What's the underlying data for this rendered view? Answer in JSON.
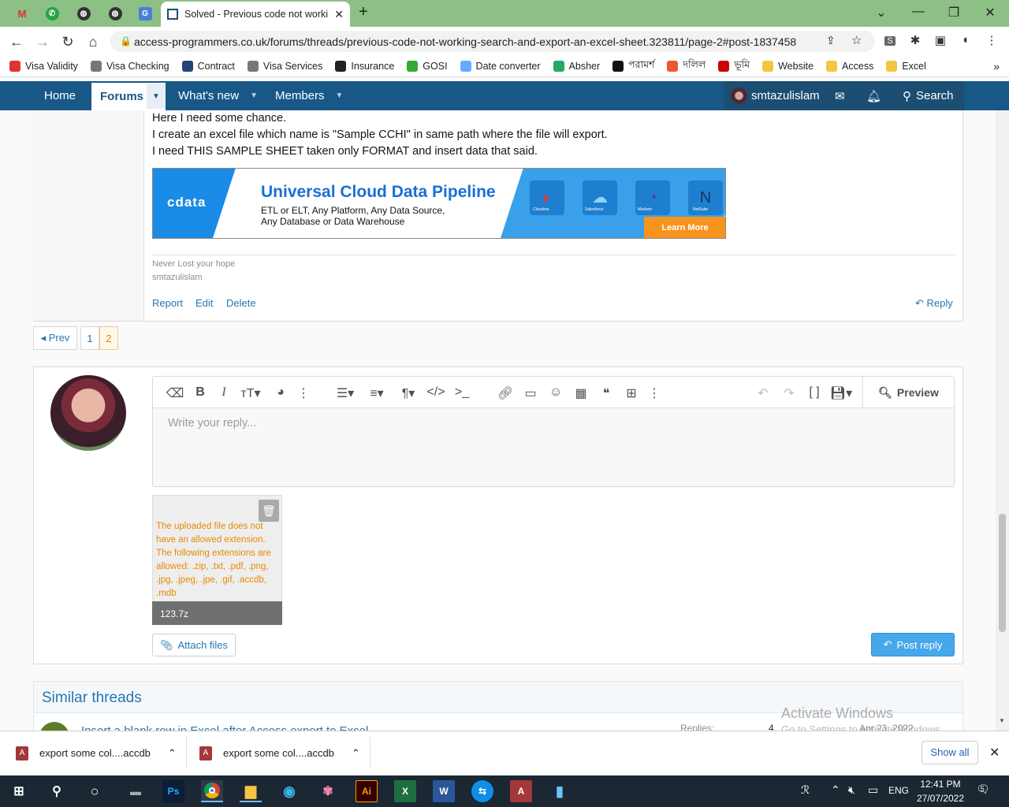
{
  "browser": {
    "active_tab_title": "Solved - Previous code not worki",
    "url": "access-programmers.co.uk/forums/threads/previous-code-not-working-search-and-export-an-excel-sheet.323811/page-2#post-1837458",
    "new_tab_label": "+",
    "bookmarks": [
      "Visa Validity",
      "Visa Checking",
      "Contract",
      "Visa Services",
      "Insurance",
      "GOSI",
      "Date converter",
      "Absher",
      "পরামর্শ",
      "দলিল",
      "ভূমি",
      "Website",
      "Access",
      "Excel"
    ],
    "bookmark_colors": [
      "#d33",
      "#777",
      "#247",
      "#777",
      "#222",
      "#3a3",
      "#6af",
      "#2a6",
      "#111",
      "#e53",
      "#c00",
      "#f5c542",
      "#f5c542",
      "#f5c542"
    ],
    "more_bookmarks": "»"
  },
  "site_nav": {
    "home": "Home",
    "forums": "Forums",
    "whats_new": "What's new",
    "members": "Members",
    "username": "smtazulislam",
    "search": "Search"
  },
  "post": {
    "lines": [
      "Here I need some chance.",
      "I create an excel file which name is \"Sample CCHI\" in same path where the file will export.",
      "I need THIS SAMPLE SHEET taken only FORMAT and insert data that said."
    ],
    "signature_line1": "Never Lost your hope",
    "signature_line2": "smtazulislam",
    "actions": {
      "report": "Report",
      "edit": "Edit",
      "delete": "Delete",
      "reply": "Reply"
    }
  },
  "ad": {
    "brand": "cdata",
    "headline": "Universal Cloud Data Pipeline",
    "sub1": "ETL or ELT, Any Platform, Any Data Source,",
    "sub2": "Any Database or Data Warehouse",
    "cta": "Learn More",
    "tiles": [
      "Cloudera",
      "Salesforce",
      "Marketo",
      "NetSuite"
    ]
  },
  "pagination": {
    "prev": "◂ Prev",
    "pages": [
      "1",
      "2"
    ],
    "current": "2"
  },
  "editor": {
    "placeholder": "Write your reply...",
    "preview": "Preview",
    "upload_error": "The uploaded file does not have an allowed extension. The following extensions are allowed: .zip, .txt, .pdf, .png, .jpg, .jpeg, .jpe, .gif, .accdb, .mdb",
    "upload_filename": "123.7z",
    "attach_files": "Attach files",
    "post_reply": "Post reply"
  },
  "similar": {
    "heading": "Similar threads",
    "row_title": "Insert a blank row in Excel after Access export to Excel",
    "row_replies_label": "Replies:",
    "row_replies": "4",
    "row_date": "Apr 23, 2022"
  },
  "watermark": {
    "line1": "Activate Windows",
    "line2": "Go to Settings to activate Windows."
  },
  "downloads": {
    "items": [
      "export some col....accdb",
      "export some col....accdb"
    ],
    "show_all": "Show all"
  },
  "taskbar": {
    "lang": "ENG",
    "time": "12:41 PM",
    "date": "27/07/2022",
    "notifications": "5"
  }
}
